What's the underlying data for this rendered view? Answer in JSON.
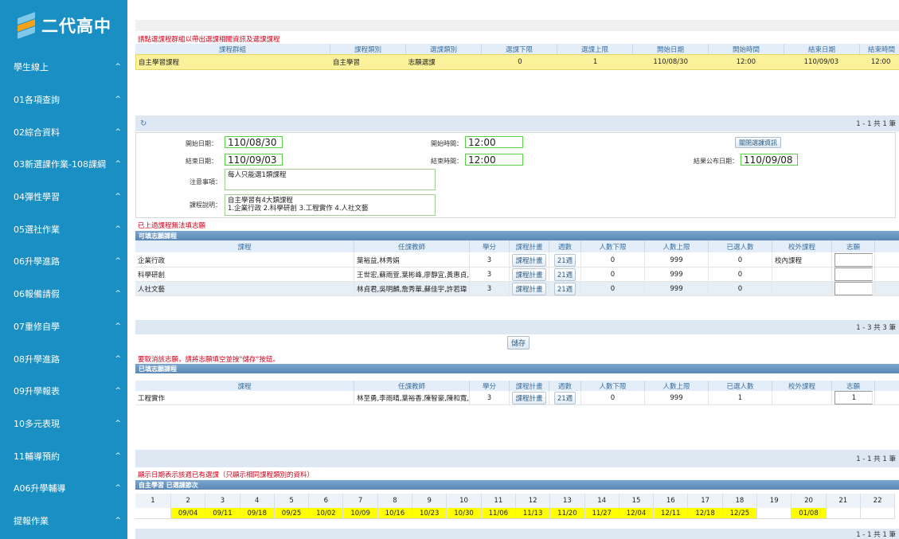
{
  "sidebar": {
    "logo_text": "二代高中",
    "items": [
      {
        "label": "學生線上"
      },
      {
        "label": "01各項查詢"
      },
      {
        "label": "02綜合資料"
      },
      {
        "label": "03新選課作業-108課綱"
      },
      {
        "label": "04彈性學習"
      },
      {
        "label": "05選社作業"
      },
      {
        "label": "06升學進路"
      },
      {
        "label": "06報備請假"
      },
      {
        "label": "07重修自學"
      },
      {
        "label": "08升學進路"
      },
      {
        "label": "09升學報表"
      },
      {
        "label": "10多元表現"
      },
      {
        "label": "11輔導預約"
      },
      {
        "label": "A06升學輔導"
      },
      {
        "label": "提報作業"
      }
    ],
    "chevron": "^"
  },
  "top": {
    "instruction": "請點選課程群組以帶出選課相關資訊及選課課程",
    "headers": [
      "課程群組",
      "課程類別",
      "選課類別",
      "選課下限",
      "選課上限",
      "開始日期",
      "開始時間",
      "結束日期",
      "結束時間"
    ],
    "row": [
      "自主學習課程",
      "自主學習",
      "志願選課",
      "0",
      "1",
      "110/08/30",
      "12:00",
      "110/09/03",
      "12:00"
    ],
    "pager": "1 - 1 共 1 筆",
    "refresh_icon": "refresh-icon"
  },
  "form": {
    "start_date_label": "開始日期：",
    "start_date": "110/08/30",
    "start_time_label": "開始時間：",
    "start_time": "12:00",
    "end_date_label": "結束日期：",
    "end_date": "110/09/03",
    "end_time_label": "結束時間：",
    "end_time": "12:00",
    "publish_label": "結果公布日期：",
    "publish_date": "110/09/08",
    "notes_label": "注意事項：",
    "notes": "每人只能選1類課程",
    "desc_label": "課程說明：",
    "desc_line1": "自主學習有4大類課程",
    "desc_line2": "1.企業行政 2.科學研創 3.工程實作 4.人社文藝",
    "close_button": "關閉選課資訊"
  },
  "available": {
    "warning": "已上過課程無法填志願",
    "title": "可填志願課程",
    "headers": [
      "課程",
      "任課教師",
      "學分",
      "課程計畫",
      "週數",
      "人數下限",
      "人數上限",
      "已選人數",
      "校外課程",
      "志願"
    ],
    "rows": [
      {
        "course": "企業行政",
        "teacher": "葉裕益,林秀娟",
        "credit": "3",
        "plan": "課程計畫",
        "weeks": "21週",
        "min": "0",
        "max": "999",
        "selected": "0",
        "external": "校內課程",
        "wish": ""
      },
      {
        "course": "科學研創",
        "teacher": "王世宏,蘇雨萱,葉彬峰,廖靜宜,黃惠貞,李慧芬",
        "credit": "3",
        "plan": "課程計畫",
        "weeks": "21週",
        "min": "0",
        "max": "999",
        "selected": "0",
        "external": "",
        "wish": ""
      },
      {
        "course": "人社文藝",
        "teacher": "林貞君,吳明麟,詹秀華,蘇佳宇,許若瑋",
        "credit": "3",
        "plan": "課程計畫",
        "weeks": "21週",
        "min": "0",
        "max": "999",
        "selected": "0",
        "external": "",
        "wish": ""
      }
    ],
    "pager": "1 - 3 共 3 筆",
    "save_button": "儲存"
  },
  "chosen": {
    "note": "要取消該志願，請將志願填空並按\"儲存\"按鈕。",
    "title": "已填志願課程",
    "headers": [
      "課程",
      "任課教師",
      "學分",
      "課程計畫",
      "週數",
      "人數下限",
      "人數上限",
      "已選人數",
      "校外課程",
      "志願"
    ],
    "rows": [
      {
        "course": "工程實作",
        "teacher": "林至勇,李雨晴,葉裕香,陳智豪,陳和寬,林涌軒",
        "credit": "3",
        "plan": "課程計畫",
        "weeks": "21週",
        "min": "0",
        "max": "999",
        "selected": "1",
        "external": "",
        "wish": "1"
      }
    ],
    "pager": "1 - 1 共 1 筆"
  },
  "schedule": {
    "note": "顯示日期表示該週已有選課（只顯示相同課程類別的資料）",
    "title": "自主學習  已選課節次",
    "weeks": [
      "1",
      "2",
      "3",
      "4",
      "5",
      "6",
      "7",
      "8",
      "9",
      "10",
      "11",
      "12",
      "13",
      "14",
      "15",
      "16",
      "17",
      "18",
      "19",
      "20",
      "21",
      "22"
    ],
    "dates": [
      "",
      "09/04",
      "09/11",
      "09/18",
      "09/25",
      "10/02",
      "10/09",
      "10/16",
      "10/23",
      "10/30",
      "11/06",
      "11/13",
      "11/20",
      "11/27",
      "12/04",
      "12/11",
      "12/18",
      "12/25",
      "",
      "01/08",
      "",
      ""
    ],
    "pager": "1 - 1 共 1 筆"
  },
  "colors": {
    "sidebar": "#1a8fc3",
    "selected_row": "#fbf19a",
    "highlight_cell": "#ffff00",
    "input_border": "#5ccf4a"
  }
}
